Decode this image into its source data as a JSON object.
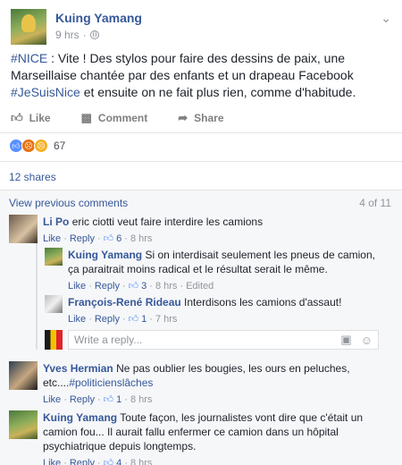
{
  "post": {
    "author": "Kuing Yamang",
    "time": "9 hrs",
    "text_pre": "#NICE",
    "text_body": " : Vite ! Des stylos pour faire des dessins de paix, une Marseillaise chantée par des enfants et un drapeau Facebook ",
    "text_hashtag": "#JeSuisNice",
    "text_post": " et ensuite on ne fait plus rien, comme d'habitude.",
    "actions": {
      "like": "Like",
      "comment": "Comment",
      "share": "Share"
    },
    "reaction_count": "67",
    "shares": "12 shares"
  },
  "comments_header": {
    "view_previous": "View previous comments",
    "count": "4 of 11"
  },
  "comments": [
    {
      "author": "Li Po",
      "text": "eric ciotti veut faire interdire les camions",
      "like": "Like",
      "reply": "Reply",
      "likes": "6",
      "time": "8 hrs"
    },
    {
      "author": "Kuing Yamang",
      "text": "Si on interdisait seulement les pneus de camion, ça paraitrait moins radical et le résultat serait le même.",
      "like": "Like",
      "reply": "Reply",
      "likes": "3",
      "time": "8 hrs",
      "edited": "Edited"
    },
    {
      "author": "François-René Rideau",
      "text": "Interdisons les camions d'assaut!",
      "like": "Like",
      "reply": "Reply",
      "likes": "1",
      "time": "7 hrs"
    },
    {
      "author": "Yves Hermian",
      "text_pre": "Ne pas oublier les bougies, les ours en peluches, etc....",
      "hashtag": "#politicienslâches",
      "like": "Like",
      "reply": "Reply",
      "likes": "1",
      "time": "8 hrs"
    },
    {
      "author": "Kuing Yamang",
      "text": "Toute façon, les journalistes vont dire que c'était un camion fou... Il aurait fallu enfermer ce camion dans un hôpital psychiatrique depuis longtemps.",
      "like": "Like",
      "reply": "Reply",
      "likes": "4",
      "time": "8 hrs"
    }
  ],
  "reply_input": {
    "placeholder": "Write a reply..."
  },
  "separator": "·",
  "icons": {
    "more": "chevron-down-icon",
    "globe": "globe-icon",
    "like": "thumbs-up-icon",
    "comment": "comment-icon",
    "share": "share-icon",
    "camera": "camera-icon",
    "emoji": "smiley-icon"
  },
  "colors": {
    "link": "#365899",
    "muted": "#90949c",
    "like_blue": "#5890ff"
  }
}
